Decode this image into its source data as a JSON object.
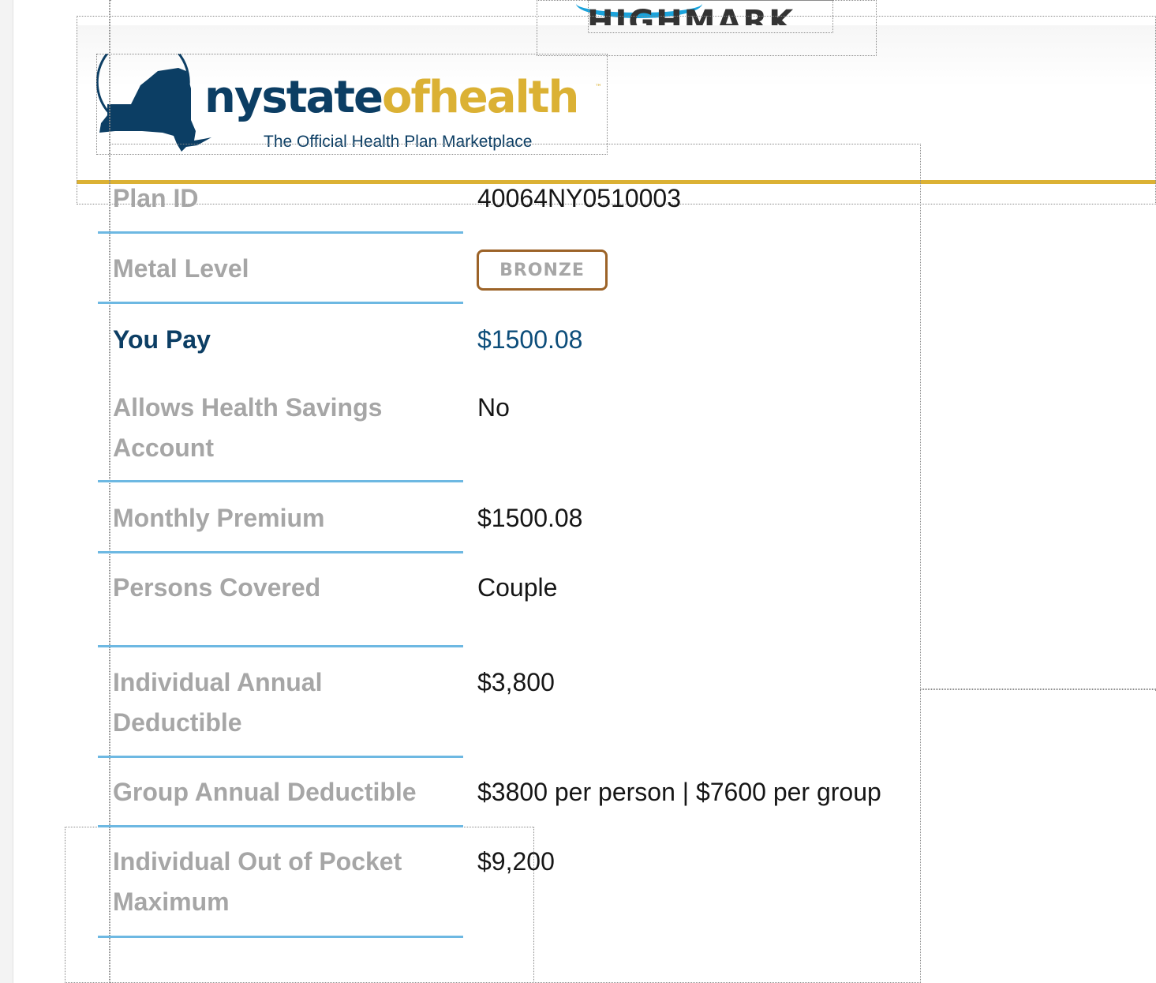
{
  "carrier": {
    "name": "HIGHMARK"
  },
  "marketplace": {
    "brand_part1": "nystate",
    "brand_part2": "ofhealth",
    "trademark": "™",
    "tagline": "The Official Health Plan Marketplace"
  },
  "plan": {
    "plan_id": {
      "label": "Plan ID",
      "value": "40064NY0510003"
    },
    "metal_level": {
      "label": "Metal Level",
      "value": "BRONZE"
    },
    "you_pay": {
      "label": "You Pay",
      "value": "$1500.08"
    },
    "hsa": {
      "label_line1": "Allows Health Savings",
      "label_line2": "Account",
      "value": "No"
    },
    "monthly_premium": {
      "label": "Monthly Premium",
      "value": "$1500.08"
    },
    "persons_covered": {
      "label": "Persons Covered",
      "value": "Couple"
    },
    "individual_deductible": {
      "label_line1": "Individual Annual",
      "label_line2": "Deductible",
      "value": "$3,800"
    },
    "group_deductible": {
      "label": "Group Annual Deductible",
      "value": "$3800 per person | $7600 per group"
    },
    "individual_oop_max": {
      "label_line1": "Individual Out of Pocket",
      "label_line2": "Maximum",
      "value": "$9,200"
    }
  },
  "colors": {
    "brand_navy": "#0c3e64",
    "brand_gold": "#dbb134",
    "separator_blue": "#6db8e2",
    "bronze": "#9c6328",
    "label_gray": "#a6a6a6"
  }
}
